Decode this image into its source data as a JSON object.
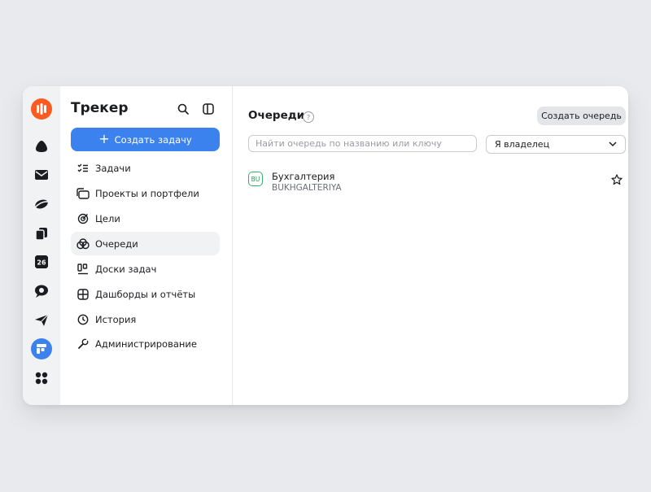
{
  "rail": {
    "items": [
      {
        "name": "app-logo-icon"
      },
      {
        "name": "home-icon"
      },
      {
        "name": "mail-icon"
      },
      {
        "name": "disk-icon"
      },
      {
        "name": "documents-icon"
      },
      {
        "name": "calendar-icon",
        "label": "26"
      },
      {
        "name": "messenger-icon"
      },
      {
        "name": "telemost-icon"
      },
      {
        "name": "tracker-icon"
      },
      {
        "name": "all-apps-icon"
      }
    ]
  },
  "sidebar": {
    "title": "Трекер",
    "create_task_label": "Создать задачу",
    "nav": [
      {
        "label": "Задачи",
        "icon": "tasks-icon"
      },
      {
        "label": "Проекты и портфели",
        "icon": "projects-icon"
      },
      {
        "label": "Цели",
        "icon": "goals-icon"
      },
      {
        "label": "Очереди",
        "icon": "queues-icon",
        "active": true
      },
      {
        "label": "Доски задач",
        "icon": "boards-icon"
      },
      {
        "label": "Дашборды и отчёты",
        "icon": "dashboards-icon"
      },
      {
        "label": "История",
        "icon": "history-icon"
      },
      {
        "label": "Администрирование",
        "icon": "admin-icon"
      }
    ]
  },
  "main": {
    "title": "Очереди",
    "help": "?",
    "create_queue_label": "Создать очередь",
    "search_placeholder": "Найти очередь по названию или ключу",
    "owner_filter": "Я владелец",
    "queues": [
      {
        "badge": "BU",
        "name": "Бухгалтерия",
        "key": "BUKHGALTERIYA"
      }
    ]
  },
  "colors": {
    "accent": "#3b82ee",
    "logo": "#fc5a1e",
    "badge_green": "#39b26c"
  }
}
